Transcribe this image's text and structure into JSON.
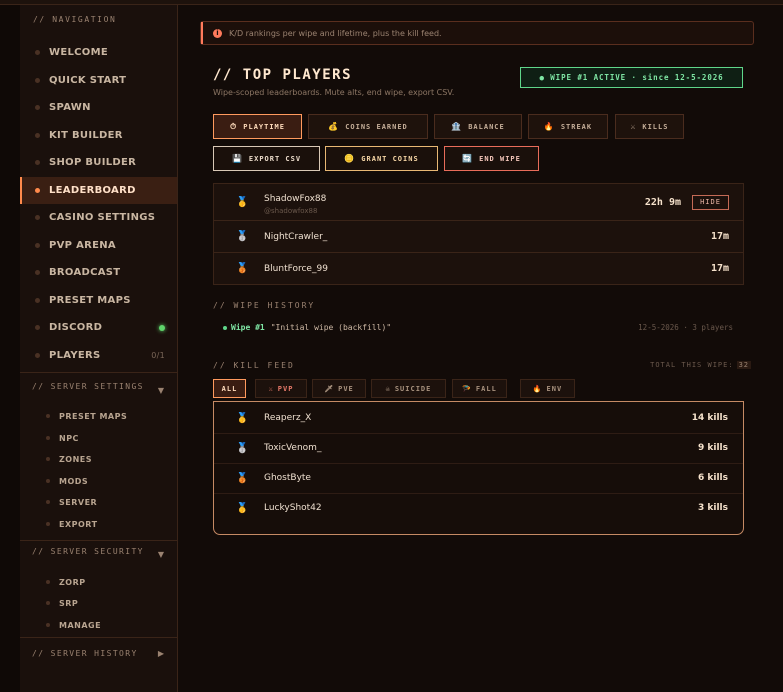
{
  "sidebar": {
    "nav_heading": "// NAVIGATION",
    "items": [
      {
        "label": "WELCOME"
      },
      {
        "label": "QUICK START"
      },
      {
        "label": "SPAWN"
      },
      {
        "label": "KIT BUILDER"
      },
      {
        "label": "SHOP BUILDER"
      },
      {
        "label": "LEADERBOARD",
        "active": true
      },
      {
        "label": "CASINO SETTINGS"
      },
      {
        "label": "PVP ARENA"
      },
      {
        "label": "BROADCAST"
      },
      {
        "label": "PRESET MAPS"
      },
      {
        "label": "DISCORD",
        "status": "online"
      },
      {
        "label": "PLAYERS",
        "count": "0/1"
      }
    ],
    "server_settings": {
      "heading": "// SERVER SETTINGS",
      "items": [
        "PRESET MAPS",
        "NPC",
        "ZONES",
        "MODS",
        "SERVER",
        "EXPORT"
      ]
    },
    "server_security": {
      "heading": "// SERVER SECURITY",
      "items": [
        "ZORP",
        "SRP",
        "MANAGE"
      ]
    },
    "server_history": {
      "heading": "// SERVER HISTORY"
    }
  },
  "banner": {
    "text": "K/D rankings per wipe and lifetime, plus the kill feed."
  },
  "header": {
    "title": "// TOP PLAYERS",
    "subtitle": "Wipe-scoped leaderboards. Mute alts, end wipe, export CSV.",
    "wipe_badge": "● WIPE #1 ACTIVE · since 12-5-2026"
  },
  "sort_tabs": [
    {
      "label": "PLAYTIME",
      "icon": "clock-icon",
      "glyph": "⏱",
      "active": true
    },
    {
      "label": "COINS EARNED",
      "icon": "coin-bag-icon",
      "glyph": "💰"
    },
    {
      "label": "BALANCE",
      "icon": "bank-icon",
      "glyph": "🏦"
    },
    {
      "label": "STREAK",
      "icon": "fire-icon",
      "glyph": "🔥"
    },
    {
      "label": "KILLS",
      "icon": "swords-icon",
      "glyph": "⚔"
    }
  ],
  "actions": [
    {
      "label": "EXPORT CSV",
      "icon": "floppy-icon",
      "glyph": "💾"
    },
    {
      "label": "GRANT COINS",
      "icon": "coin-icon",
      "glyph": "🪙"
    },
    {
      "label": "END WIPE",
      "icon": "refresh-icon",
      "glyph": "🔄"
    }
  ],
  "players": [
    {
      "name": "ShadowFox88",
      "handle": "@shadowfox88",
      "value": "22h 9m",
      "hide_label": "HIDE",
      "medal": "🥇"
    },
    {
      "name": "NightCrawler_",
      "value": "17m",
      "medal": "🥈"
    },
    {
      "name": "BluntForce_99",
      "value": "17m",
      "medal": "🥉"
    }
  ],
  "wipe_history": {
    "heading": "// WIPE HISTORY",
    "entries": [
      {
        "wipe": "Wipe #1",
        "name": "\"Initial wipe (backfill)\"",
        "meta": "12-5-2026 · 3 players"
      }
    ]
  },
  "kill_feed": {
    "heading": "// KILL FEED",
    "total_label": "TOTAL THIS WIPE:",
    "total_value": "32",
    "filters": [
      {
        "label": "ALL",
        "active": true
      },
      {
        "label": "PVP",
        "glyph": "⚔"
      },
      {
        "label": "PVE",
        "glyph": "🗡"
      },
      {
        "label": "SUICIDE",
        "glyph": "☠"
      },
      {
        "label": "FALL",
        "glyph": "🪂"
      },
      {
        "label": "ENV",
        "glyph": "🔥"
      }
    ],
    "entries": [
      {
        "name": "Reaperz_X",
        "kills": "14 kills",
        "medal": "🥇"
      },
      {
        "name": "ToxicVenom_",
        "kills": "9 kills",
        "medal": "🥈"
      },
      {
        "name": "GhostByte",
        "kills": "6 kills",
        "medal": "🥉"
      },
      {
        "name": "LuckyShot42",
        "kills": "3 kills",
        "medal": "🥇"
      }
    ]
  },
  "colors": {
    "accent": "#ff8a4c",
    "success": "#5fd68a",
    "danger": "#e86c5a",
    "background": "#120b08"
  }
}
